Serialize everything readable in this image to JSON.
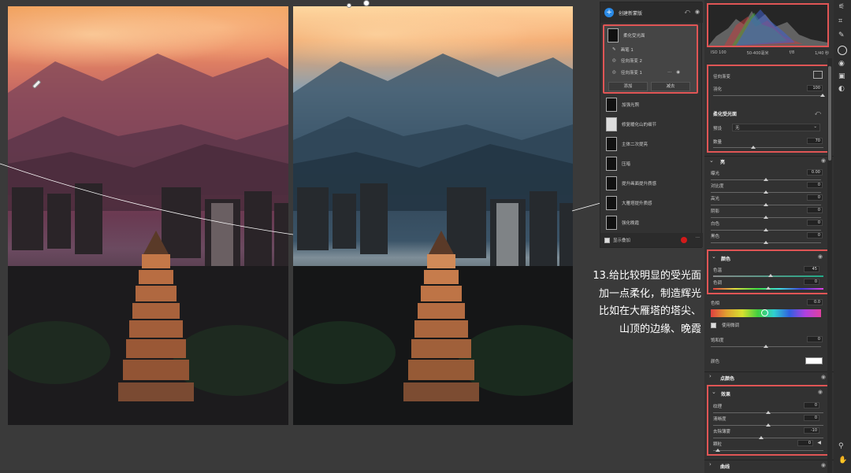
{
  "layers_panel": {
    "create_mask": "创建新蒙版",
    "active_mask": "柔化受光面",
    "sub_items": [
      "画笔 1",
      "径向渐变 2",
      "径向渐变 1"
    ],
    "add_label": "添加",
    "subtract_label": "减去",
    "layers": [
      "加强光照",
      "修复暖化山的细节",
      "主体二次提亮",
      "压暗",
      "提升画面提升质感",
      "大雁塔提升质感",
      "强化晚霞"
    ],
    "show_overlay": "显示叠加"
  },
  "caption": {
    "lines": [
      "13.给比较明显的受光面",
      "加一点柔化，制造辉光",
      "比如在大雁塔的塔尖、",
      "山顶的边缘、晚霞"
    ]
  },
  "histogram": {
    "meta": [
      "ISO 100",
      "50-400MM 焦距",
      "f/8",
      "1/40 秒"
    ],
    "meta_full": [
      "ISO 100",
      "50-400毫米",
      "f/8",
      "1/40 秒"
    ]
  },
  "mask_section": {
    "title": "径向渐变",
    "feather_label": "羽化",
    "feather_value": "100"
  },
  "preset_section": {
    "title": "柔化受光面",
    "preset_label": "预设",
    "preset_value": "无",
    "amount_label": "数量",
    "amount_value": "70"
  },
  "light": {
    "title": "亮",
    "rows": [
      {
        "label": "曝光",
        "value": "0.00"
      },
      {
        "label": "对比度",
        "value": "0"
      },
      {
        "label": "高光",
        "value": "0"
      },
      {
        "label": "阴影",
        "value": "0"
      },
      {
        "label": "白色",
        "value": "0"
      },
      {
        "label": "黑色",
        "value": "0"
      }
    ]
  },
  "color": {
    "title": "颜色",
    "rows": [
      {
        "label": "色温",
        "value": "45"
      },
      {
        "label": "色调",
        "value": "0"
      }
    ],
    "hue_label": "色相",
    "hue_value": "0.0",
    "use_fine": "使用微调",
    "saturation_label": "饱和度",
    "saturation_value": "0",
    "color_label": "颜色"
  },
  "point_color": {
    "title": "点颜色"
  },
  "effects": {
    "title": "效果",
    "rows": [
      {
        "label": "纹理",
        "value": "0"
      },
      {
        "label": "清晰度",
        "value": "0"
      },
      {
        "label": "去除薄雾",
        "value": "-10"
      },
      {
        "label": "颗粒",
        "value": "0"
      }
    ]
  },
  "curve": {
    "title": "曲线"
  },
  "colors": {
    "accent_red": "#e05555",
    "blue": "#2a8ae6"
  }
}
